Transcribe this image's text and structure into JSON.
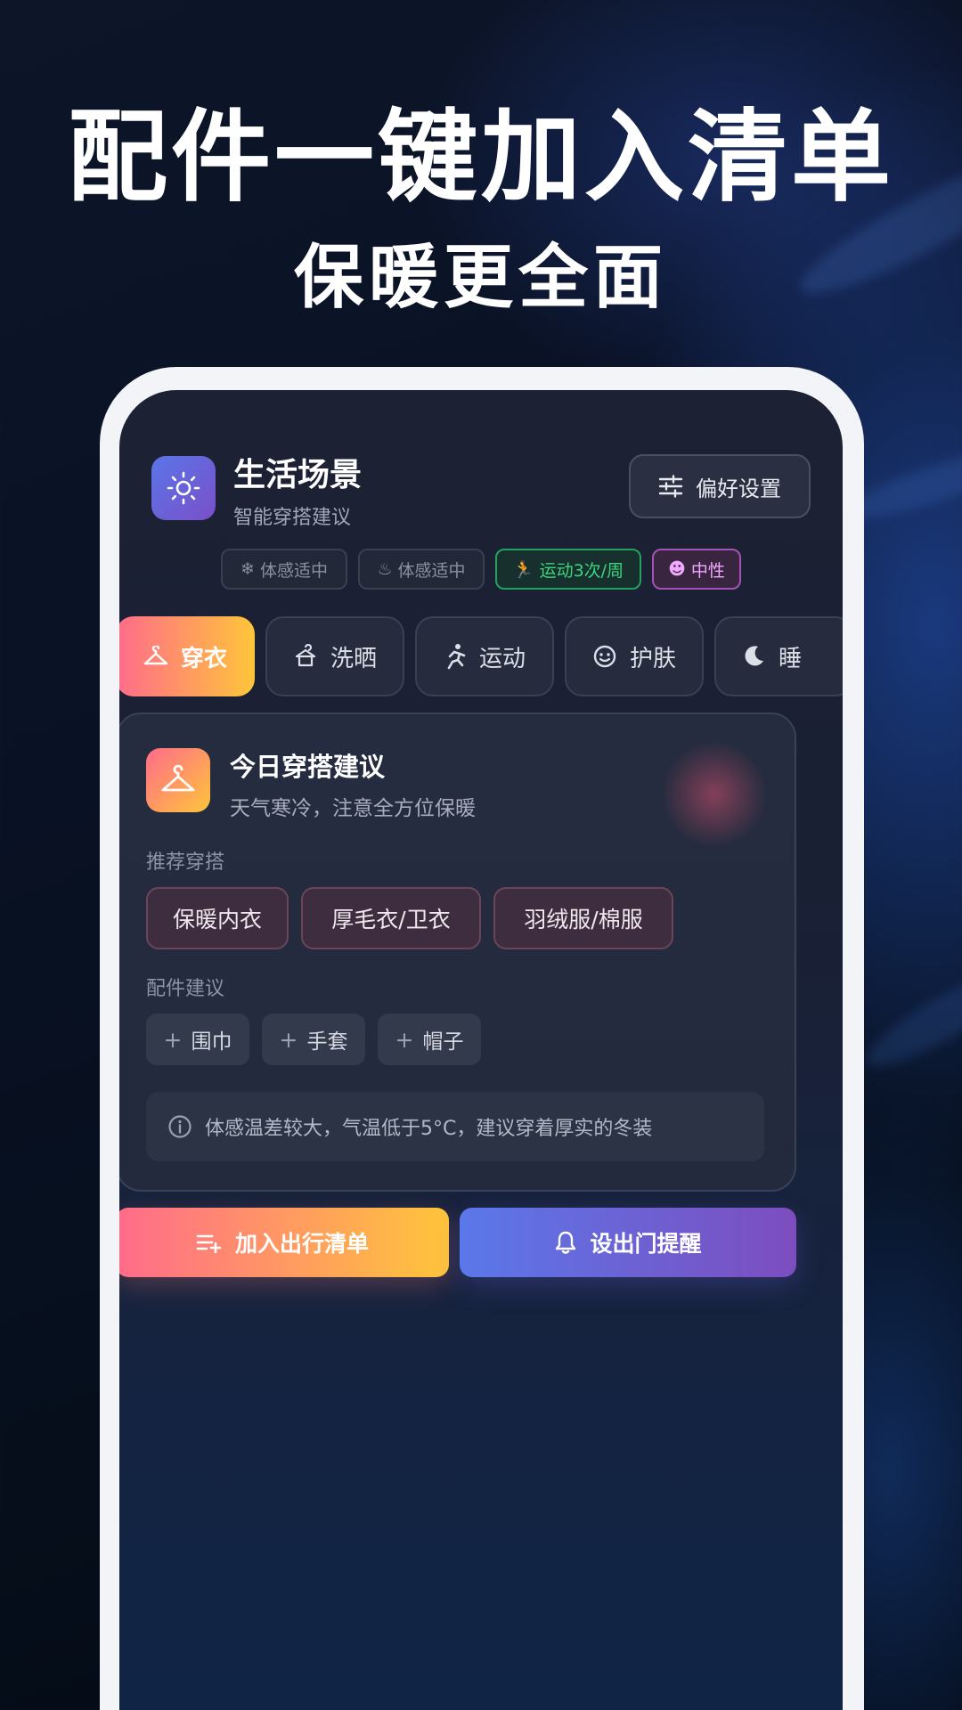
{
  "promo": {
    "headline": "配件一键加入清单",
    "subline": "保暖更全面"
  },
  "header": {
    "title": "生活场景",
    "subtitle": "智能穿搭建议",
    "preference_button": "偏好设置",
    "app_icon": "sun-icon"
  },
  "tags": [
    {
      "label": "体感适中",
      "icon": "snowflake-icon",
      "style": "neutral"
    },
    {
      "label": "体感适中",
      "icon": "flame-icon",
      "style": "neutral"
    },
    {
      "label": "运动3次/周",
      "icon": "running-icon",
      "style": "green"
    },
    {
      "label": "中性",
      "icon": "face-icon",
      "style": "pink"
    }
  ],
  "tabs": [
    {
      "label": "穿衣",
      "icon": "hanger-icon",
      "active": true
    },
    {
      "label": "洗晒",
      "icon": "laundry-icon",
      "active": false
    },
    {
      "label": "运动",
      "icon": "running-icon",
      "active": false
    },
    {
      "label": "护肤",
      "icon": "face-icon",
      "active": false
    },
    {
      "label": "睡",
      "icon": "moon-icon",
      "active": false
    }
  ],
  "card": {
    "title": "今日穿搭建议",
    "subtitle": "天气寒冷，注意全方位保暖",
    "outfit_label": "推荐穿搭",
    "outfits": [
      "保暖内衣",
      "厚毛衣/卫衣",
      "羽绒服/棉服"
    ],
    "accessory_label": "配件建议",
    "accessories": [
      "围巾",
      "手套",
      "帽子"
    ],
    "note": "体感温差较大，气温低于5°C，建议穿着厚实的冬装"
  },
  "actions": {
    "add_to_list": "加入出行清单",
    "set_reminder": "设出门提醒"
  },
  "colors": {
    "accent_gradient_start": "#ff6b8b",
    "accent_gradient_end": "#ffc53a",
    "secondary_gradient_start": "#5a78ea",
    "secondary_gradient_end": "#7d4dbf",
    "green_tag": "#3bd67e",
    "pink_tag": "#f1a8ff"
  }
}
